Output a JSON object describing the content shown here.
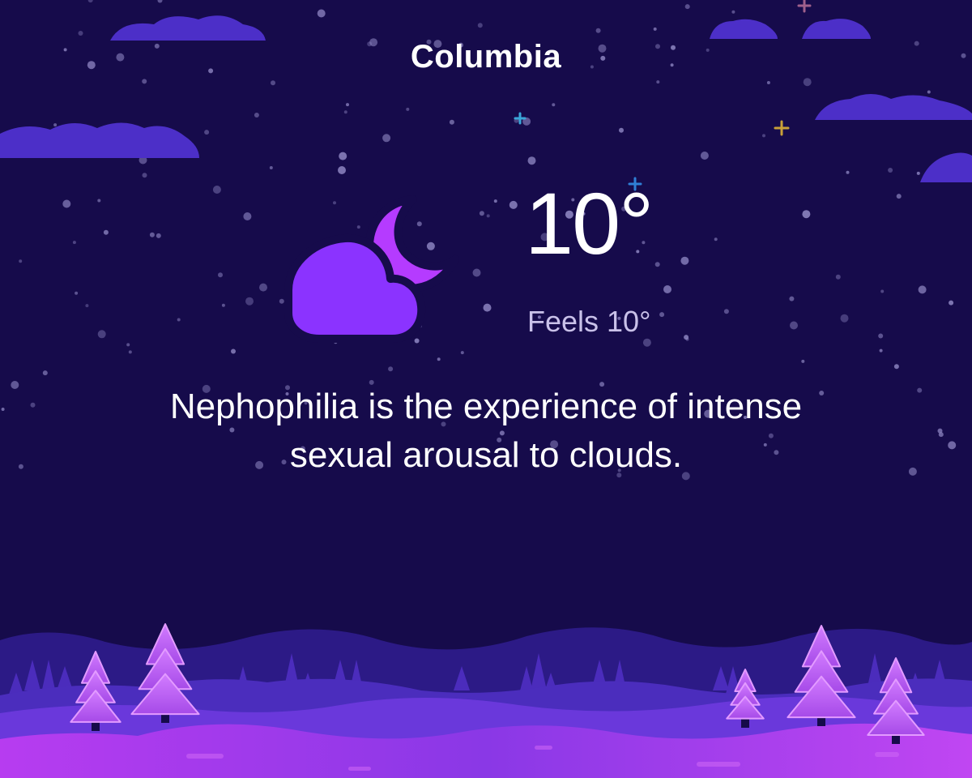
{
  "location": {
    "city": "Columbia"
  },
  "current": {
    "temperature": "10°",
    "feels_like": "Feels 10°",
    "condition_icon": "partly-cloudy-night-icon"
  },
  "fact": {
    "text": "Nephophilia is the experience of intense sexual arousal to clouds."
  },
  "colors": {
    "sky": "#160b4b",
    "cloud_dark": "#4a2cc4",
    "cloud_icon": "#8b33ff",
    "moon": "#b53bff",
    "hills_front": "#c03cf0",
    "trees": "#c060f0",
    "text_primary": "#ffffff",
    "text_secondary": "#c9c1e9"
  }
}
